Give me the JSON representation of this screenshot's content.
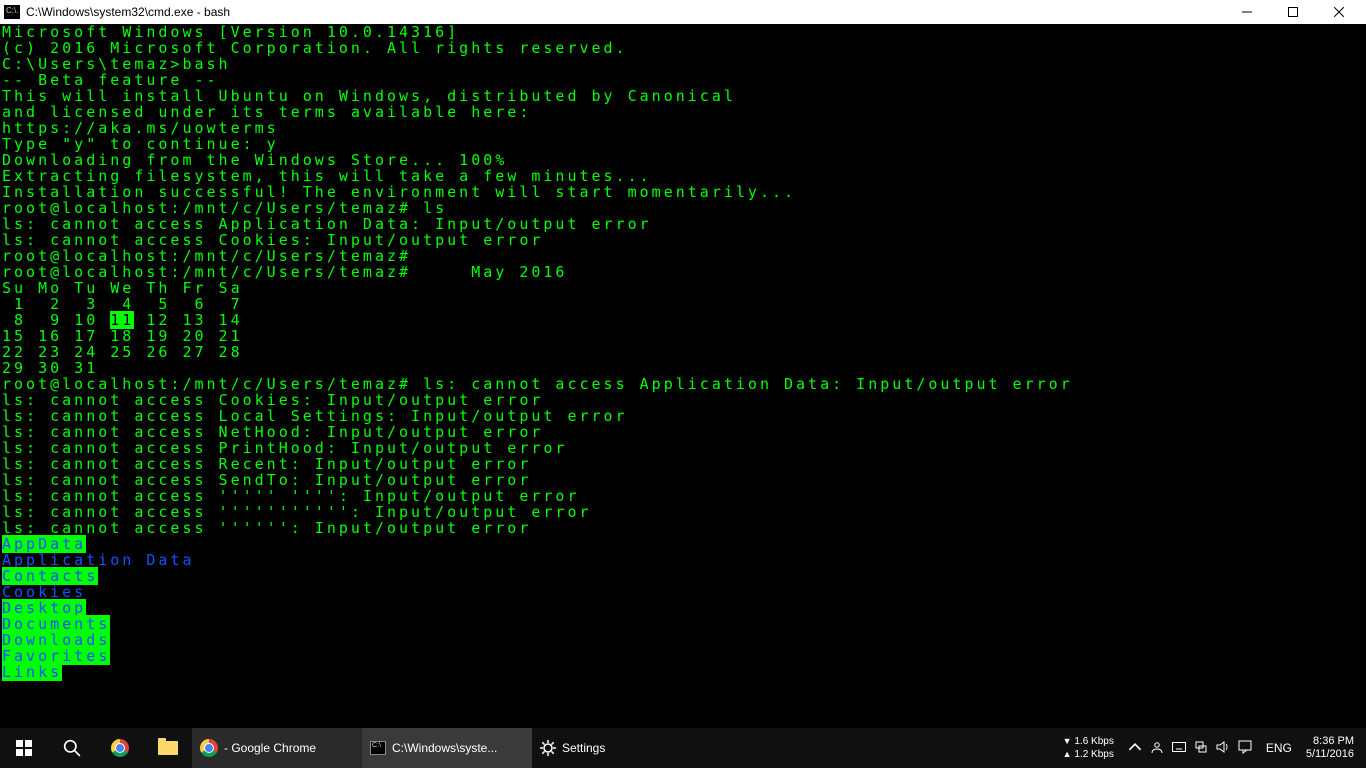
{
  "window": {
    "title": "C:\\Windows\\system32\\cmd.exe - bash",
    "icon_badge": "C:\\."
  },
  "terminal": {
    "lines": [
      {
        "t": "Microsoft Windows [Version 10.0.14316]"
      },
      {
        "t": "(c) 2016 Microsoft Corporation. All rights reserved."
      },
      {
        "t": ""
      },
      {
        "t": "C:\\Users\\temaz>bash"
      },
      {
        "t": "-- Beta feature --"
      },
      {
        "t": "This will install Ubuntu on Windows, distributed by Canonical"
      },
      {
        "t": "and licensed under its terms available here:"
      },
      {
        "t": "https://aka.ms/uowterms"
      },
      {
        "t": ""
      },
      {
        "t": "Type \"y\" to continue: y"
      },
      {
        "t": "Downloading from the Windows Store... 100%"
      },
      {
        "t": "Extracting filesystem, this will take a few minutes..."
      },
      {
        "t": "Installation successful! The environment will start momentarily..."
      },
      {
        "t": "root@localhost:/mnt/c/Users/temaz# ls"
      },
      {
        "t": "ls: cannot access Application Data: Input/output error"
      },
      {
        "t": "ls: cannot access Cookies: Input/output error"
      },
      {
        "t": "root@localhost:/mnt/c/Users/temaz#"
      },
      {
        "t": "root@localhost:/mnt/c/Users/temaz#     May 2016"
      },
      {
        "t": "Su Mo Tu We Th Fr Sa"
      },
      {
        "t": " 1  2  3  4  5  6  7"
      },
      {
        "compose": [
          " 8  9 10 ",
          {
            "cls": "hlgrn",
            "t": "11"
          },
          " 12 13 14"
        ]
      },
      {
        "t": "15 16 17 18 19 20 21"
      },
      {
        "t": "22 23 24 25 26 27 28"
      },
      {
        "t": "29 30 31"
      },
      {
        "t": ""
      },
      {
        "t": "root@localhost:/mnt/c/Users/temaz# ls: cannot access Application Data: Input/output error"
      },
      {
        "t": "ls: cannot access Cookies: Input/output error"
      },
      {
        "t": "ls: cannot access Local Settings: Input/output error"
      },
      {
        "t": "ls: cannot access NetHood: Input/output error"
      },
      {
        "t": "ls: cannot access PrintHood: Input/output error"
      },
      {
        "t": "ls: cannot access Recent: Input/output error"
      },
      {
        "t": "ls: cannot access SendTo: Input/output error"
      },
      {
        "t": "ls: cannot access ''''' '''': Input/output error"
      },
      {
        "t": "ls: cannot access ''''''''''': Input/output error"
      },
      {
        "t": "ls: cannot access '''''': Input/output error"
      },
      {
        "cls": "hlblue",
        "t": "AppData"
      },
      {
        "cls": "blue",
        "t": "Application Data"
      },
      {
        "cls": "hlblue",
        "t": "Contacts"
      },
      {
        "cls": "blue",
        "t": "Cookies"
      },
      {
        "cls": "hlblue",
        "t": "Desktop"
      },
      {
        "cls": "hlblue",
        "t": "Documents"
      },
      {
        "cls": "hlblue",
        "t": "Downloads"
      },
      {
        "cls": "hlblue",
        "t": "Favorites"
      },
      {
        "cls": "hlblue",
        "t": "Links"
      }
    ]
  },
  "taskbar": {
    "items": [
      {
        "kind": "start",
        "name": "start-button"
      },
      {
        "kind": "search",
        "name": "search-button"
      },
      {
        "kind": "chrome",
        "name": "chrome-pinned"
      },
      {
        "kind": "explorer",
        "name": "file-explorer-pinned"
      },
      {
        "kind": "chrome-running",
        "label": "- Google Chrome",
        "name": "chrome-window"
      },
      {
        "kind": "cmd-running",
        "label": "C:\\Windows\\syste...",
        "name": "cmd-window"
      },
      {
        "kind": "settings",
        "label": "Settings",
        "name": "settings-window"
      }
    ],
    "net": {
      "down": "1.6 Kbps",
      "up": "1.2 Kbps"
    },
    "lang": "ENG",
    "clock": {
      "time": "8:36 PM",
      "date": "5/11/2016"
    }
  }
}
